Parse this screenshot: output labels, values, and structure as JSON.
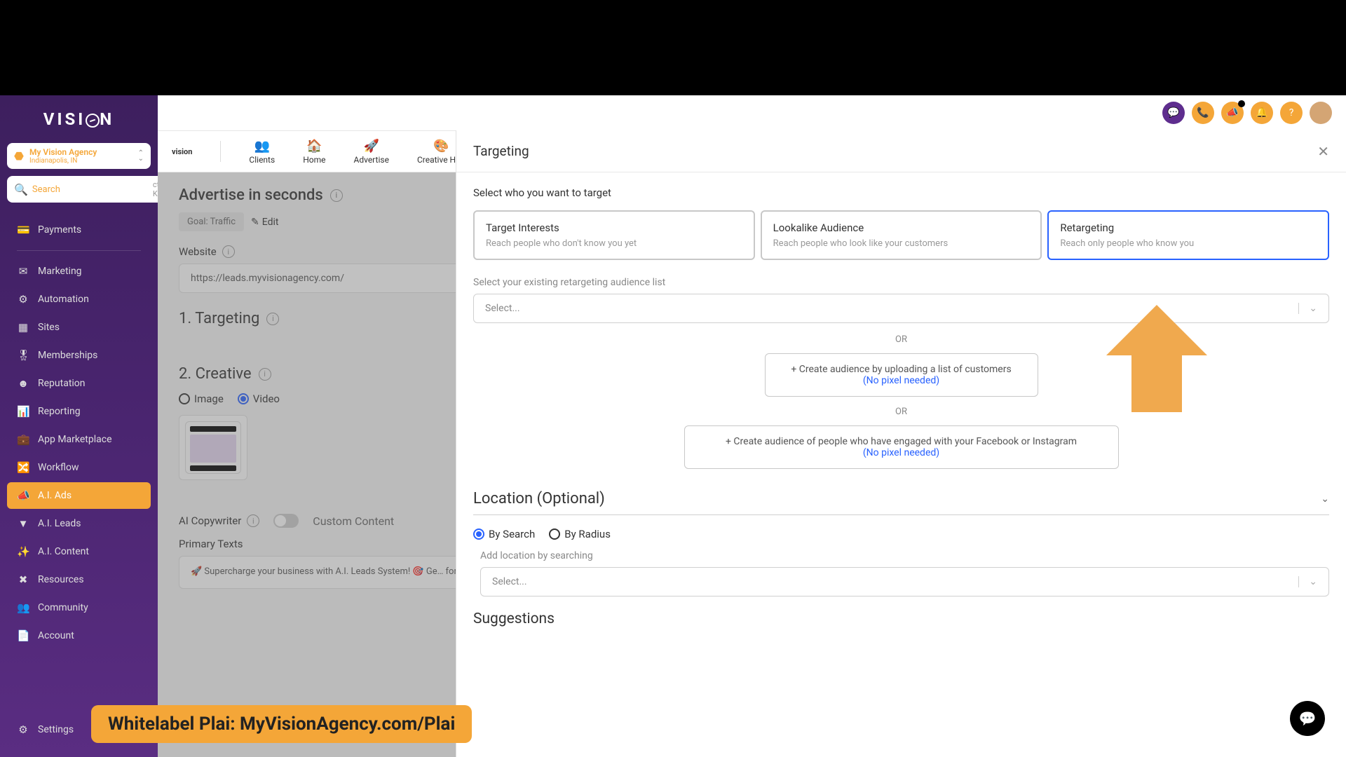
{
  "brand": "VISION",
  "location": {
    "name": "My Vision Agency",
    "sub": "Indianapolis, IN"
  },
  "search": {
    "placeholder": "Search",
    "kbd": "ctrl K"
  },
  "nav": {
    "payments": "Payments",
    "marketing": "Marketing",
    "automation": "Automation",
    "sites": "Sites",
    "memberships": "Memberships",
    "reputation": "Reputation",
    "reporting": "Reporting",
    "marketplace": "App Marketplace",
    "workflow": "Workflow",
    "aiads": "A.I. Ads",
    "aileads": "A.I. Leads",
    "aicontent": "A.I. Content",
    "resources": "Resources",
    "community": "Community",
    "account": "Account",
    "settings": "Settings"
  },
  "subtool": {
    "logo": "vision",
    "clients": "Clients",
    "home": "Home",
    "advertise": "Advertise",
    "creative": "Creative Hub"
  },
  "content": {
    "title": "Advertise in seconds",
    "goal_label": "Goal: Traffic",
    "edit": "Edit",
    "website_label": "Website",
    "website_value": "https://leads.myvisionagency.com/",
    "targeting_head": "1.  Targeting",
    "creative_head": "2. Creative",
    "radio_image": "Image",
    "radio_video": "Video",
    "ai_copy": "AI Copywriter",
    "custom_content": "Custom Content",
    "primary_texts": "Primary Texts",
    "ptext": "🚀 Supercharge your business with A.I. Leads System! 🎯 Ge… for your business using the power of artificial intelligence. 🤖 … irrelevant leads. Let our revolutionary platform find the most … 💼 Experience the future of lead generation today!"
  },
  "modal": {
    "title": "Targeting",
    "who_label": "Select who you want to target",
    "cards": [
      {
        "title": "Target Interests",
        "sub": "Reach people who don't know you yet"
      },
      {
        "title": "Lookalike Audience",
        "sub": "Reach people who look like your customers"
      },
      {
        "title": "Retargeting",
        "sub": "Reach only people who know you"
      }
    ],
    "existing_label": "Select your existing retargeting audience list",
    "select_placeholder": "Select...",
    "or": "OR",
    "create1": "+ Create audience by uploading a list of customers",
    "create2": "+ Create audience of people who have engaged with your Facebook or Instagram",
    "no_pixel": "(No pixel needed)",
    "location_head": "Location (Optional)",
    "by_search": "By Search",
    "by_radius": "By Radius",
    "add_location": "Add location by searching",
    "suggestions": "Suggestions"
  },
  "banner": "Whitelabel Plai: MyVisionAgency.com/Plai"
}
